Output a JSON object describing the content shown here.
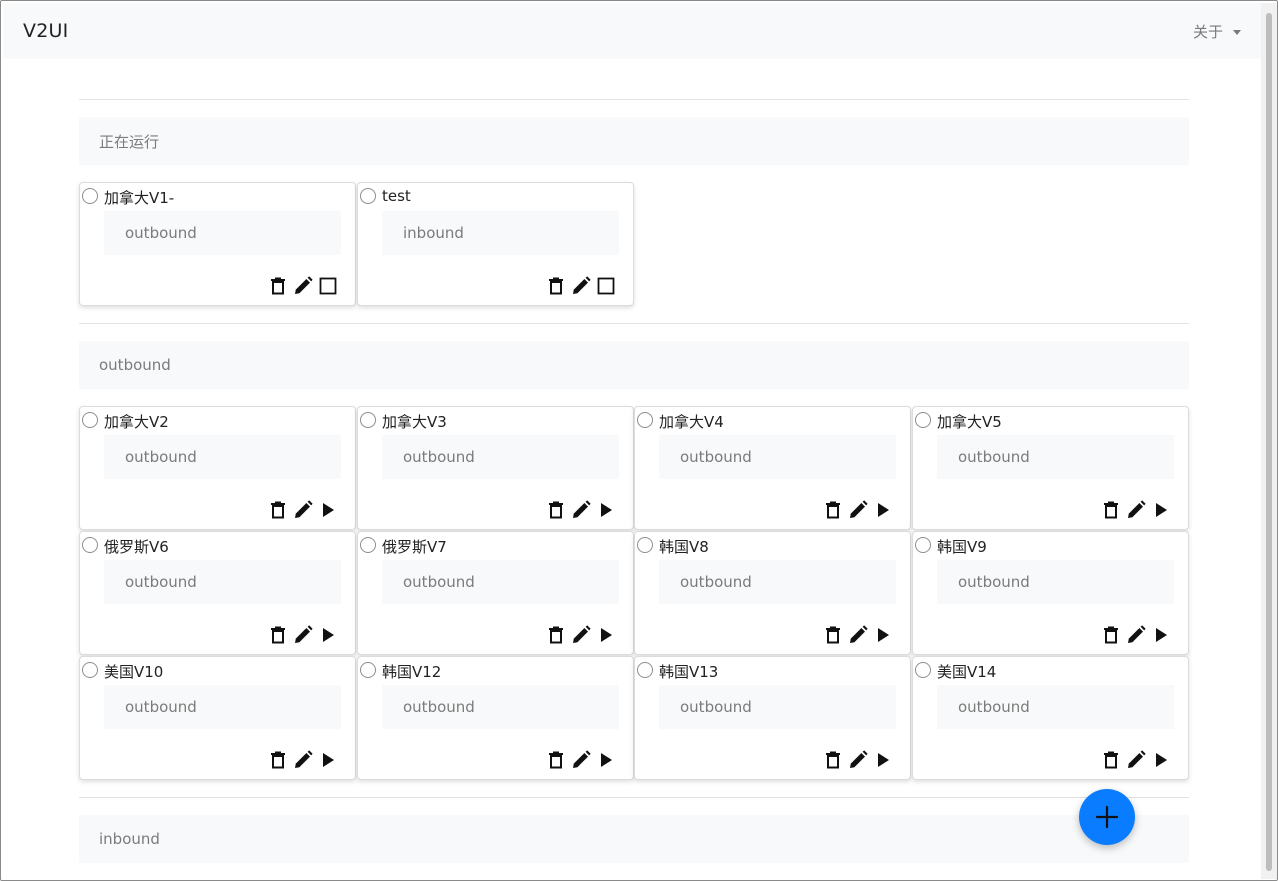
{
  "navbar": {
    "brand": "V2UI",
    "about_label": "关于"
  },
  "sections": {
    "running": {
      "title": "正在运行"
    },
    "outbound": {
      "title": "outbound"
    },
    "inbound": {
      "title": "inbound"
    }
  },
  "running_cards": [
    {
      "name": "加拿大V1-",
      "tag": "outbound",
      "actions": [
        "delete-icon",
        "edit-icon",
        "stop-icon"
      ]
    },
    {
      "name": "test",
      "tag": "inbound",
      "actions": [
        "delete-icon",
        "edit-icon",
        "stop-icon"
      ]
    }
  ],
  "outbound_cards": [
    {
      "name": "加拿大V2",
      "tag": "outbound"
    },
    {
      "name": "加拿大V3",
      "tag": "outbound"
    },
    {
      "name": "加拿大V4",
      "tag": "outbound"
    },
    {
      "name": "加拿大V5",
      "tag": "outbound"
    },
    {
      "name": "俄罗斯V6",
      "tag": "outbound"
    },
    {
      "name": "俄罗斯V7",
      "tag": "outbound"
    },
    {
      "name": "韩国V8",
      "tag": "outbound"
    },
    {
      "name": "韩国V9",
      "tag": "outbound"
    },
    {
      "name": "美国V10",
      "tag": "outbound"
    },
    {
      "name": "韩国V12",
      "tag": "outbound"
    },
    {
      "name": "韩国V13",
      "tag": "outbound"
    },
    {
      "name": "美国V14",
      "tag": "outbound"
    }
  ],
  "outbound_card_actions": [
    "delete-icon",
    "edit-icon",
    "play-icon"
  ],
  "fab": {
    "icon": "plus-icon"
  },
  "colors": {
    "accent": "#0a7cff",
    "header_bg": "#f8f9fa",
    "muted_text": "#7b7b7b"
  }
}
